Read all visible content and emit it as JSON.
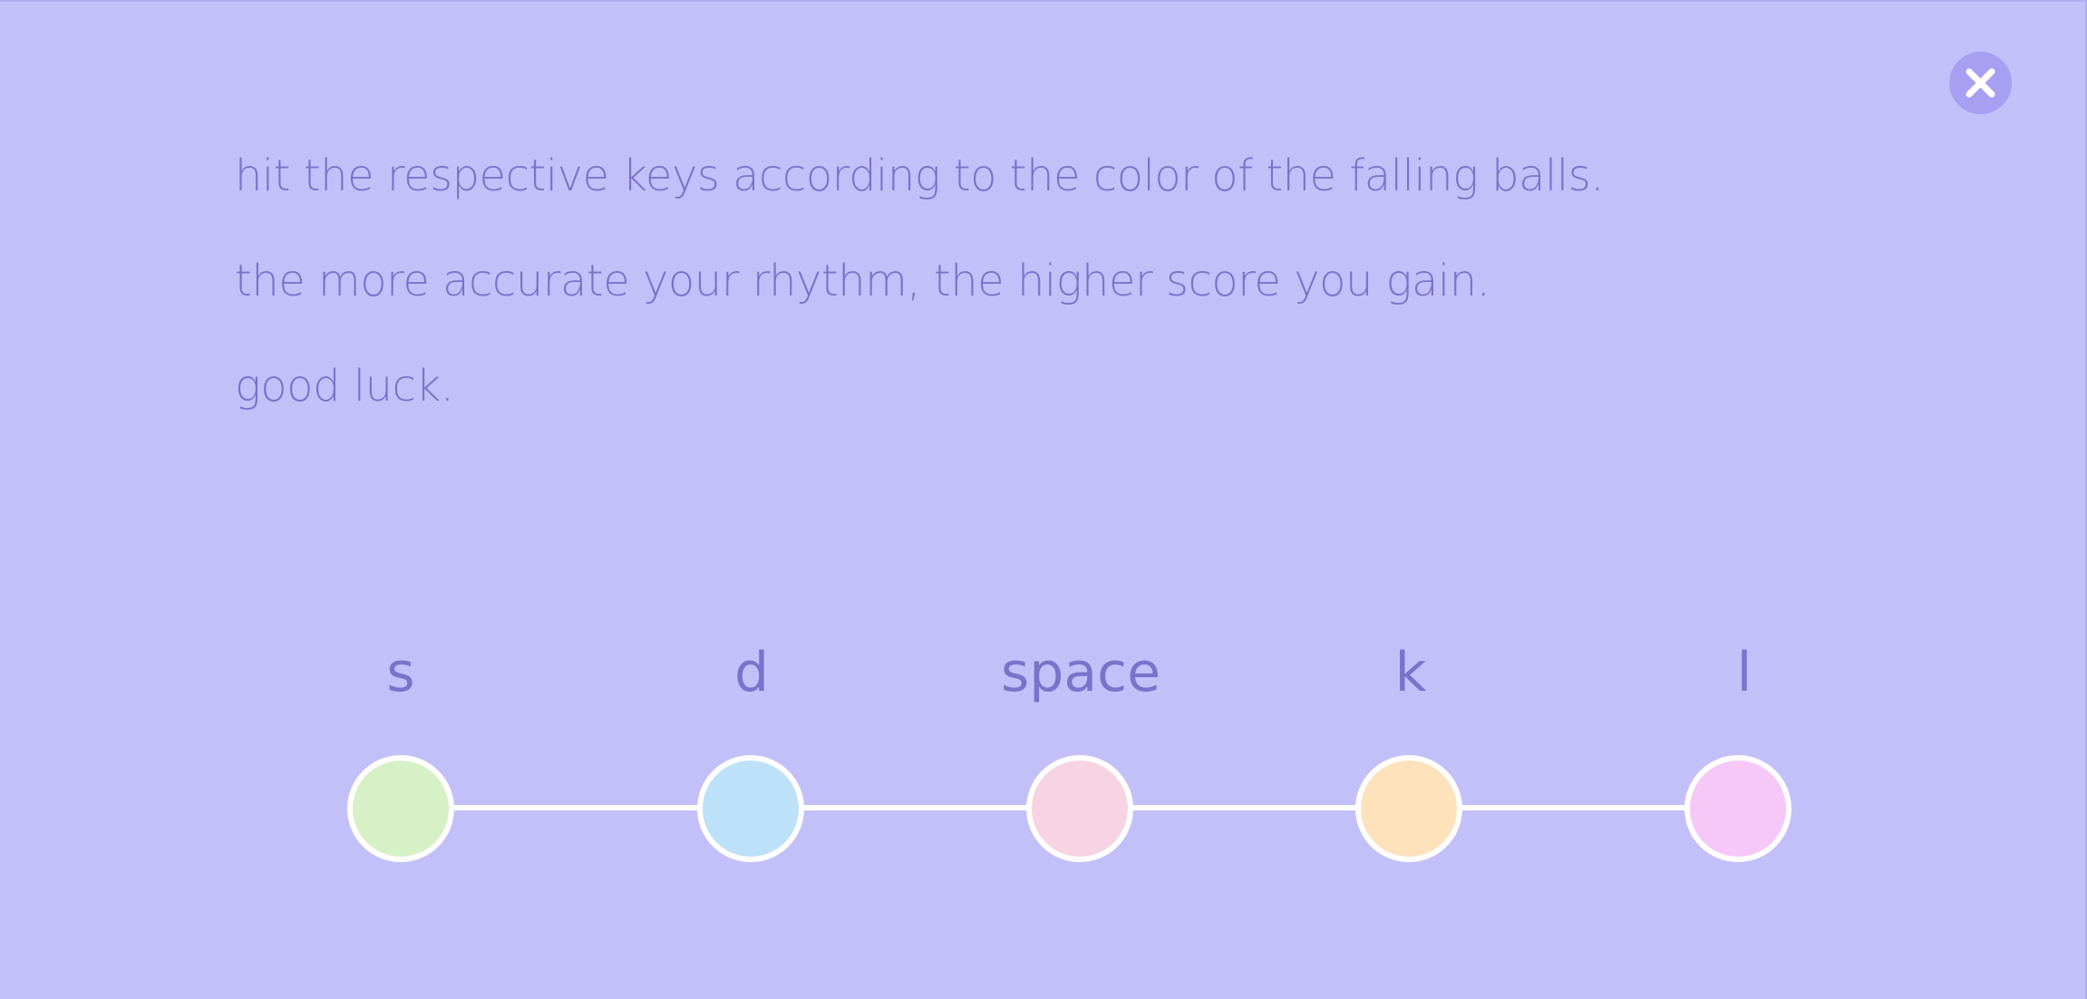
{
  "close_button": {
    "icon": "close-icon"
  },
  "instructions": {
    "line1": "hit the respective keys according to the color of the falling balls.",
    "line2": "the more accurate your rhythm, the higher score you gain.",
    "line3": "good luck."
  },
  "keys": [
    {
      "label": "s",
      "color": "#d7f1c7"
    },
    {
      "label": "d",
      "color": "#bde1f9"
    },
    {
      "label": "space",
      "color": "#f7d4e1"
    },
    {
      "label": "k",
      "color": "#fde2bb"
    },
    {
      "label": "l",
      "color": "#f6c8f7"
    }
  ],
  "colors": {
    "background": "#c3c0f9",
    "text": "#7a73cb",
    "close_button": "#a89ff3"
  }
}
